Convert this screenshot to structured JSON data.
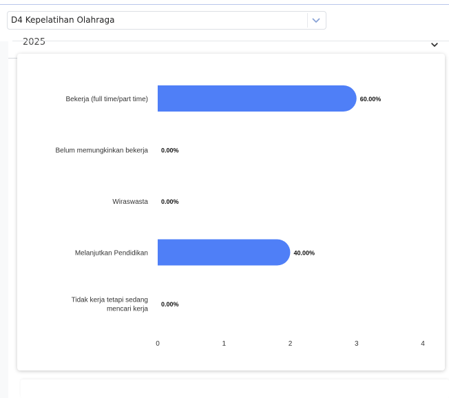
{
  "filters": {
    "program": "D4 Kepelatihan Olahraga",
    "year": "2025"
  },
  "icons": {
    "program_dropdown": "chevron-down-icon",
    "year_dropdown": "chevron-down-icon"
  },
  "colors": {
    "bar": "#4f7ff7",
    "dropdown_chevron": "#8aa4d6"
  },
  "chart_data": {
    "type": "bar",
    "orientation": "horizontal",
    "categories": [
      "Bekerja (full time/part time)",
      "Belum memungkinkan bekerja",
      "Wiraswasta",
      "Melanjutkan Pendidikan",
      "Tidak kerja tetapi sedang mencari kerja"
    ],
    "values": [
      3,
      0,
      0,
      2,
      0
    ],
    "data_labels": [
      "60.00%",
      "0.00%",
      "0.00%",
      "40.00%",
      "0.00%"
    ],
    "x_ticks": [
      "0",
      "1",
      "2",
      "3",
      "4"
    ],
    "xlim": [
      0,
      4
    ],
    "title": "",
    "xlabel": "",
    "ylabel": "",
    "grid": false,
    "legend": "none"
  }
}
